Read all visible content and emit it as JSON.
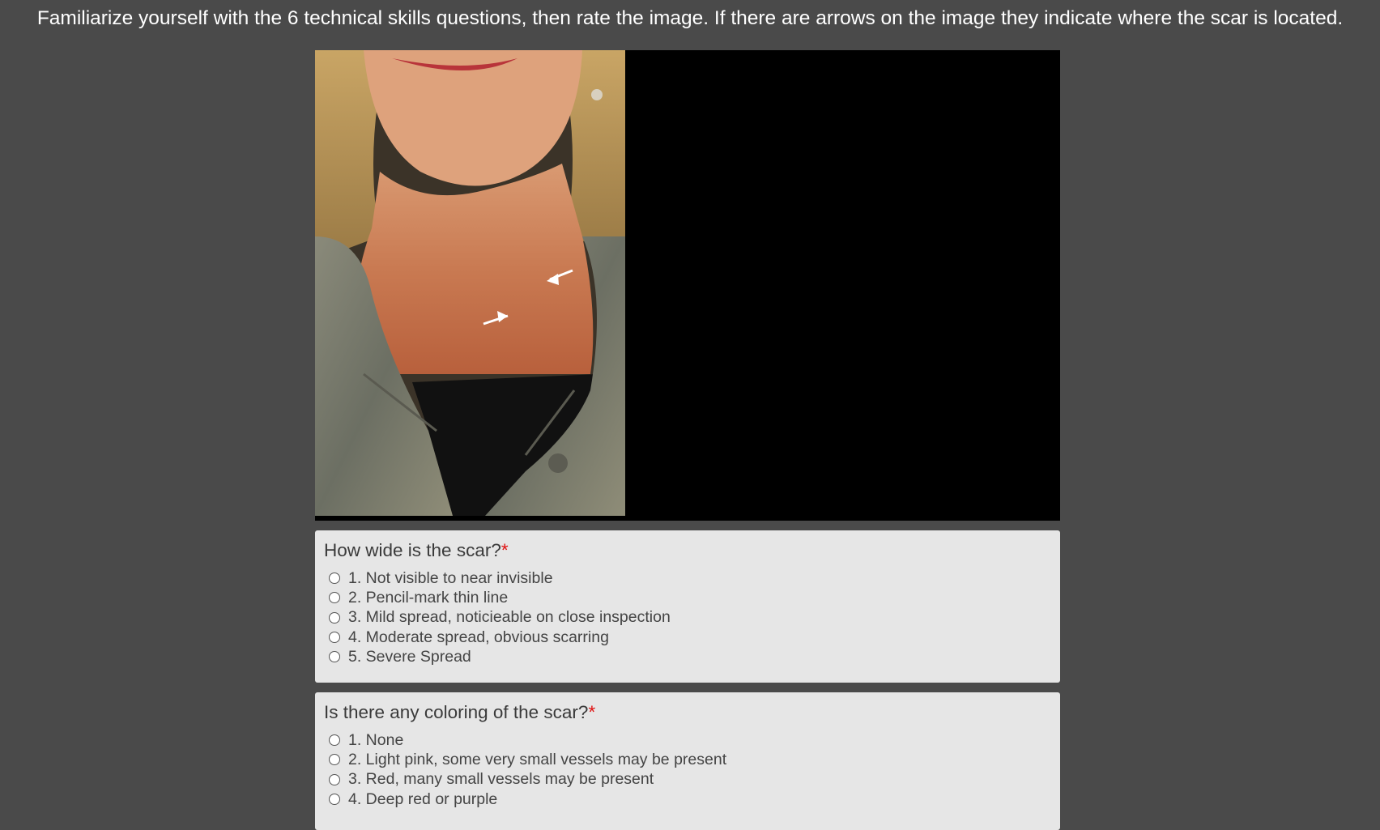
{
  "instructions": "Familiarize yourself with the 6 technical skills questions, then rate the image. If there are arrows on the image they indicate where the scar is located.",
  "image": {
    "subject": "neck-and-chest-photo",
    "has_arrows": true
  },
  "colors": {
    "page_background": "#4a4a4a",
    "card_background": "#e6e6e6",
    "required_star": "#e01010"
  },
  "questions": [
    {
      "title": "How wide is the scar?",
      "required_mark": "*",
      "options": [
        "1. Not visible to near invisible",
        "2. Pencil-mark thin line",
        "3. Mild spread, noticieable on close inspection",
        "4. Moderate spread, obvious scarring",
        "5. Severe Spread"
      ]
    },
    {
      "title": "Is there any coloring of the scar?",
      "required_mark": "*",
      "options": [
        "1. None",
        "2. Light pink, some very small vessels may be present",
        "3. Red, many small vessels may be present",
        "4. Deep red or purple"
      ]
    }
  ]
}
